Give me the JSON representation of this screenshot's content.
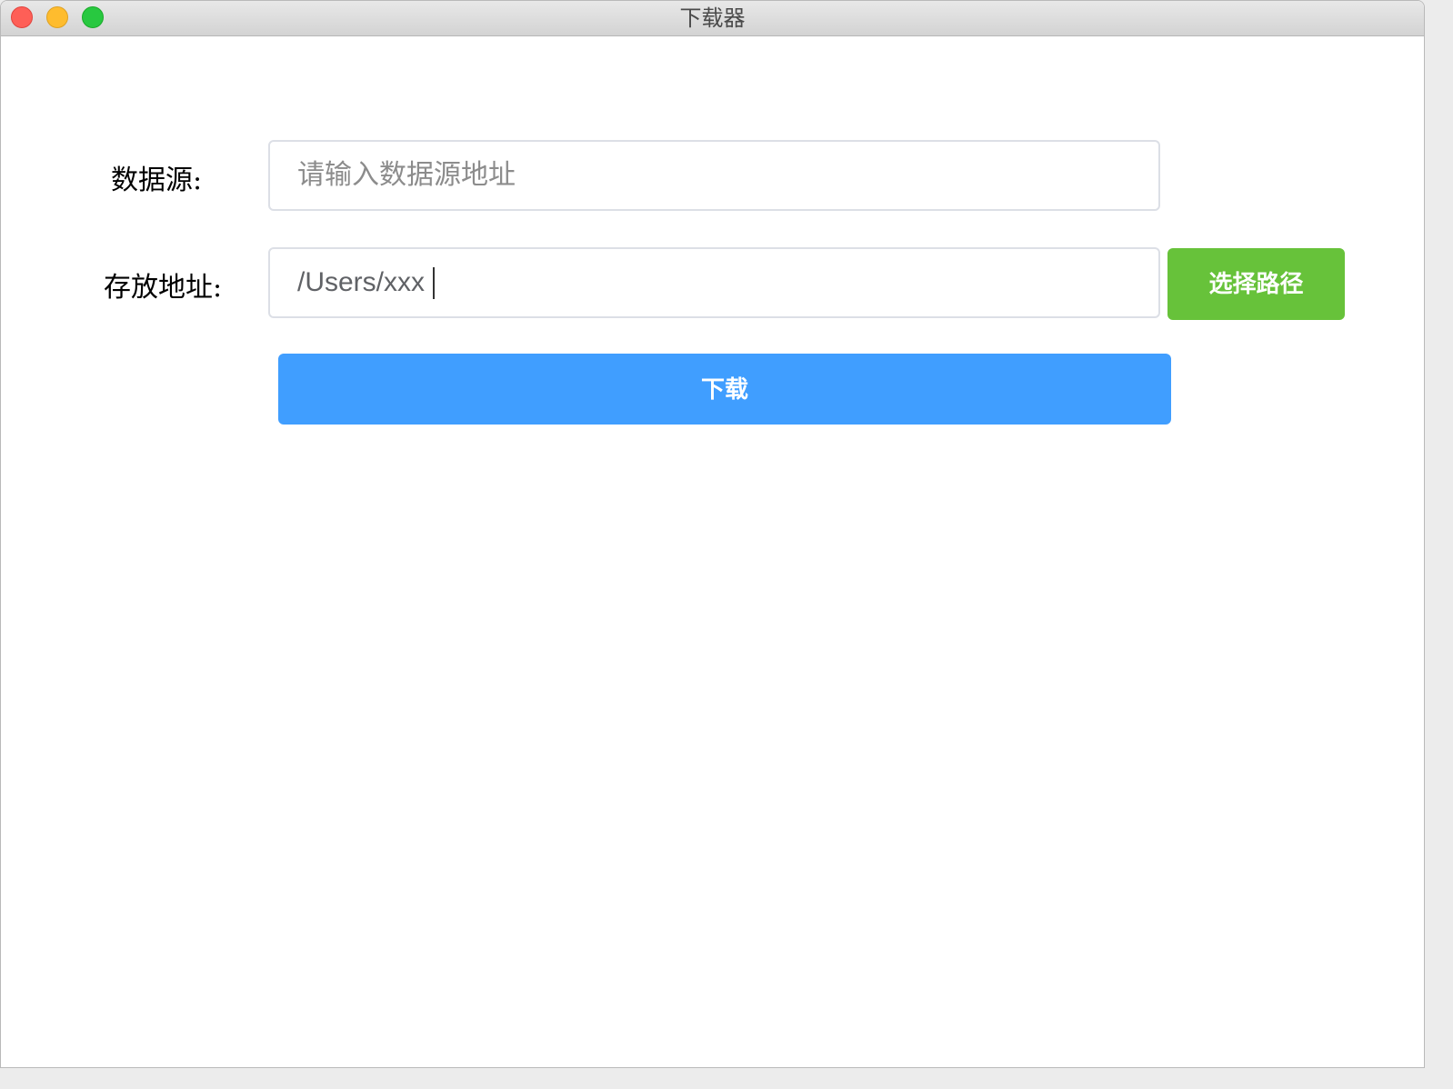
{
  "window": {
    "title": "下载器"
  },
  "form": {
    "source_label": "数据源:",
    "source_placeholder": "请输入数据源地址",
    "source_value": "",
    "path_label": "存放地址:",
    "path_value": "/Users/xxx",
    "select_path_button": "选择路径",
    "download_button": "下载"
  },
  "colors": {
    "primary": "#409eff",
    "success": "#67c23a",
    "input_border": "#dcdfe6"
  }
}
